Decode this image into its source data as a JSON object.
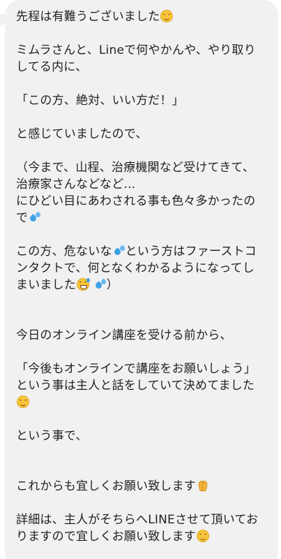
{
  "message": {
    "lines": [
      {
        "text": "先程は有難うございました",
        "emoji": "smiling-face-icon"
      },
      {
        "text": ""
      },
      {
        "text": "ミムラさんと、Lineで何やかんや、やり取り"
      },
      {
        "text": "してる内に、"
      },
      {
        "text": ""
      },
      {
        "text": "「この方、絶対、いい方だ！」"
      },
      {
        "text": ""
      },
      {
        "text": "と感じていましたので、"
      },
      {
        "text": ""
      },
      {
        "text": "（今まで、山程、治療機関など受けてきて、"
      },
      {
        "text": "治療家さんなどなど..."
      },
      {
        "text": "にひどい目にあわされる事も色々多かったの"
      },
      {
        "text": "で",
        "emoji": "sweat-droplets-icon"
      },
      {
        "text": ""
      },
      {
        "text": "この方、危ないな",
        "emoji_inline": "sweat-droplets-icon",
        "text_after": "という方はファーストコ"
      },
      {
        "text": "ンタクトで、何となくわかるようになってし"
      },
      {
        "text": "まいました",
        "emoji": "grinning-sweat-icon",
        "emoji2": "sweat-droplets-icon",
        "text_after": "）"
      },
      {
        "text": ""
      },
      {
        "text": ""
      },
      {
        "text": "今日のオンライン講座を受ける前から、"
      },
      {
        "text": ""
      },
      {
        "text": "「今後もオンラインで講座をお願いしょう」"
      },
      {
        "text": "という事は主人と話をしていて決めてました"
      },
      {
        "text": "",
        "emoji": "smiling-face-icon"
      },
      {
        "text": ""
      },
      {
        "text": "という事で、"
      },
      {
        "text": ""
      },
      {
        "text": ""
      },
      {
        "text": "これからも宜しくお願い致します",
        "emoji": "folded-hands-icon"
      },
      {
        "text": ""
      },
      {
        "text": "詳細は、主人がそちらへLINEさせて頂いてお"
      },
      {
        "text": "りますので宜しくお願い致します",
        "emoji": "smiling-face-icon"
      }
    ]
  }
}
